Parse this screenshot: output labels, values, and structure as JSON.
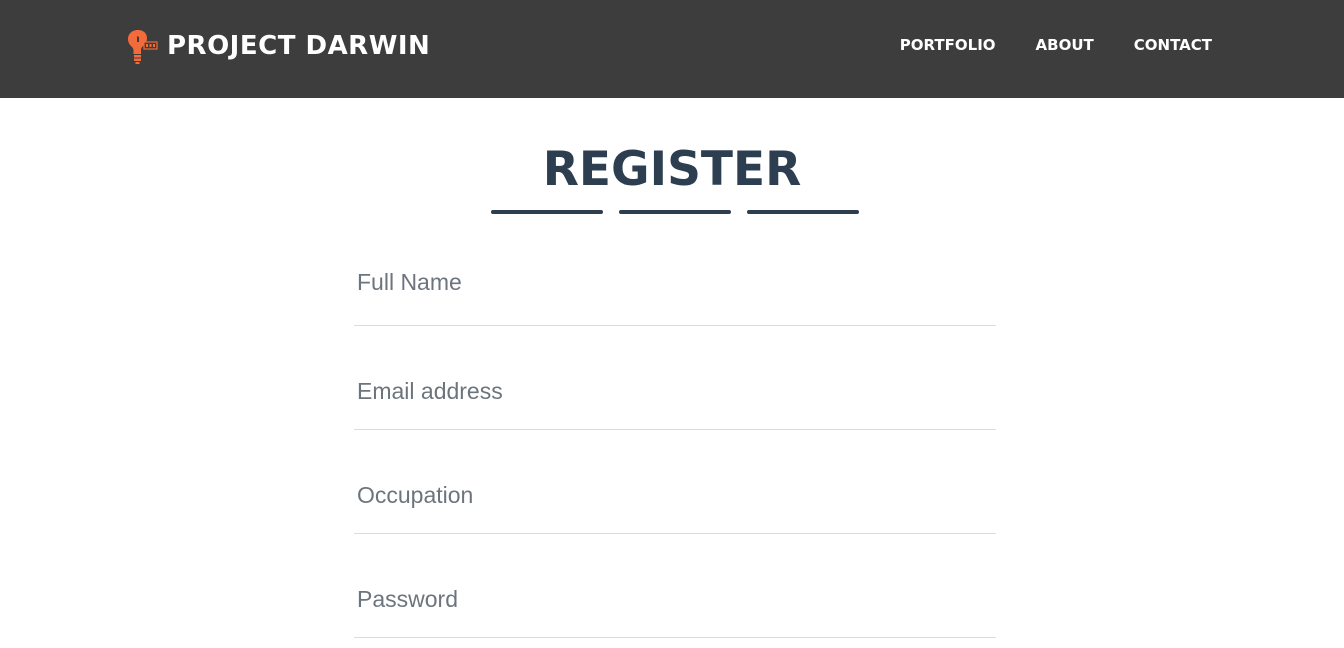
{
  "navbar": {
    "brand": "PROJECT DARWIN",
    "links": [
      "PORTFOLIO",
      "ABOUT",
      "CONTACT"
    ]
  },
  "main": {
    "title": "REGISTER",
    "fields": [
      {
        "placeholder": "Full Name"
      },
      {
        "placeholder": "Email address"
      },
      {
        "placeholder": "Occupation"
      },
      {
        "placeholder": "Password"
      }
    ]
  },
  "colors": {
    "navbar_bg": "#3d3d3d",
    "brand_accent": "#f26b3a",
    "title": "#2c3e50",
    "placeholder": "#6c757d",
    "field_border": "#dcdcdc"
  },
  "icons": {
    "brand_logo": "lightbulb-logo-icon"
  }
}
